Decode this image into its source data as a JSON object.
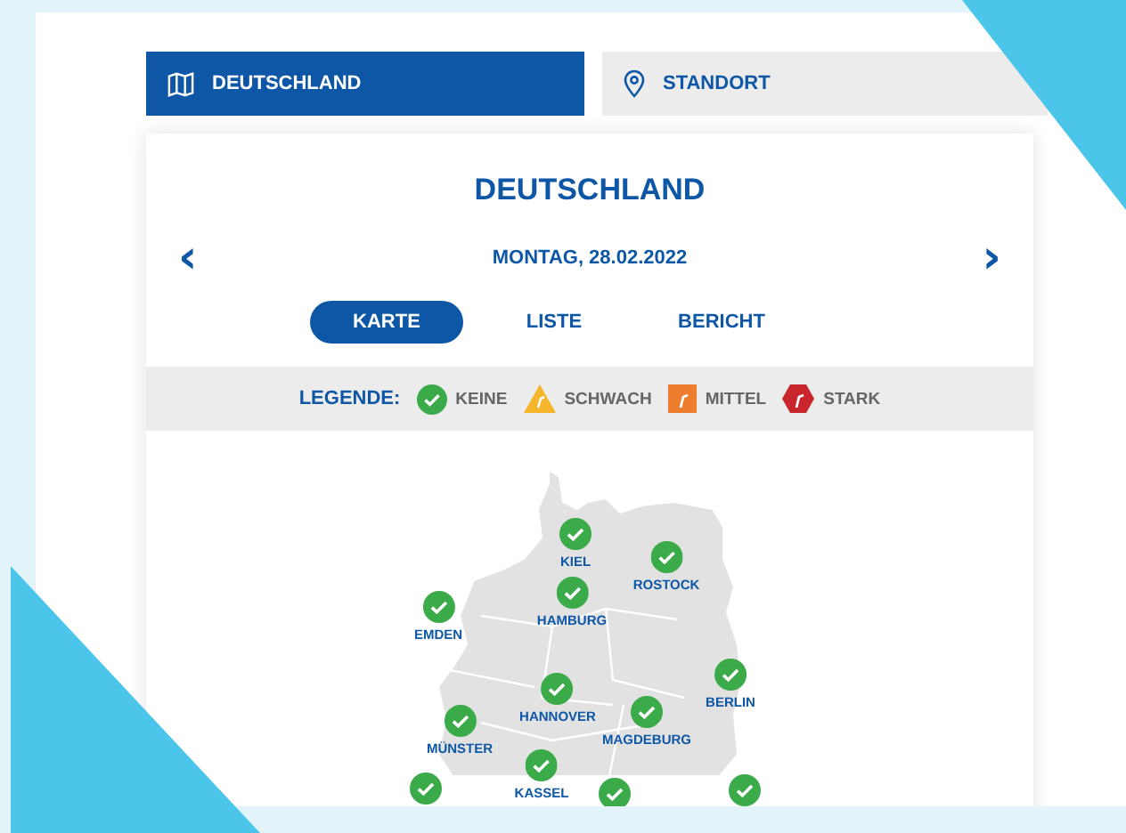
{
  "top_tabs": [
    {
      "label": "DEUTSCHLAND",
      "selected": true
    },
    {
      "label": "STANDORT",
      "selected": false
    }
  ],
  "card": {
    "title": "DEUTSCHLAND",
    "date": "MONTAG, 28.02.2022",
    "prev_arrow": "‹",
    "next_arrow": "›",
    "view_tabs": [
      {
        "label": "KARTE",
        "selected": true
      },
      {
        "label": "LISTE",
        "selected": false
      },
      {
        "label": "BERICHT",
        "selected": false
      }
    ],
    "legend": {
      "label": "LEGENDE:",
      "items": [
        {
          "kind": "keine",
          "label": "KEINE"
        },
        {
          "kind": "schwach",
          "label": "SCHWACH"
        },
        {
          "kind": "mittel",
          "label": "MITTEL"
        },
        {
          "kind": "stark",
          "label": "STARK"
        }
      ]
    },
    "map": {
      "cities": [
        {
          "name": "KIEL",
          "kind": "keine"
        },
        {
          "name": "ROSTOCK",
          "kind": "keine"
        },
        {
          "name": "HAMBURG",
          "kind": "keine"
        },
        {
          "name": "EMDEN",
          "kind": "keine"
        },
        {
          "name": "BERLIN",
          "kind": "keine"
        },
        {
          "name": "HANNOVER",
          "kind": "keine"
        },
        {
          "name": "MAGDEBURG",
          "kind": "keine"
        },
        {
          "name": "MÜNSTER",
          "kind": "keine"
        },
        {
          "name": "KASSEL",
          "kind": "keine"
        },
        {
          "kind": "keine"
        },
        {
          "kind": "keine"
        },
        {
          "kind": "keine"
        }
      ]
    }
  }
}
